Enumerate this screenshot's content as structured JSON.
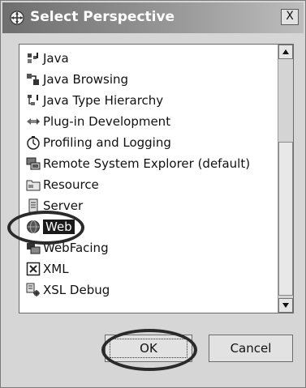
{
  "dialog": {
    "title": "Select Perspective",
    "title_icon": "perspective-icon",
    "close_label": "X"
  },
  "perspectives": [
    {
      "label": "Java",
      "icon": "java-icon"
    },
    {
      "label": "Java Browsing",
      "icon": "java-browsing-icon"
    },
    {
      "label": "Java Type Hierarchy",
      "icon": "java-type-hierarchy-icon"
    },
    {
      "label": "Plug-in Development",
      "icon": "plugin-development-icon"
    },
    {
      "label": "Profiling and Logging",
      "icon": "profiling-icon"
    },
    {
      "label": "Remote System Explorer (default)",
      "icon": "remote-system-explorer-icon"
    },
    {
      "label": "Resource",
      "icon": "resource-folder-icon"
    },
    {
      "label": "Server",
      "icon": "server-icon"
    },
    {
      "label": "Web",
      "icon": "web-globe-icon",
      "selected": true
    },
    {
      "label": "WebFacing",
      "icon": "webfacing-icon"
    },
    {
      "label": "XML",
      "icon": "xml-icon"
    },
    {
      "label": "XSL Debug",
      "icon": "xsl-debug-icon"
    }
  ],
  "buttons": {
    "ok": "OK",
    "cancel": "Cancel"
  },
  "colors": {
    "selection_bg": "#1a1a1a",
    "annotation": "#2a2a2a"
  }
}
